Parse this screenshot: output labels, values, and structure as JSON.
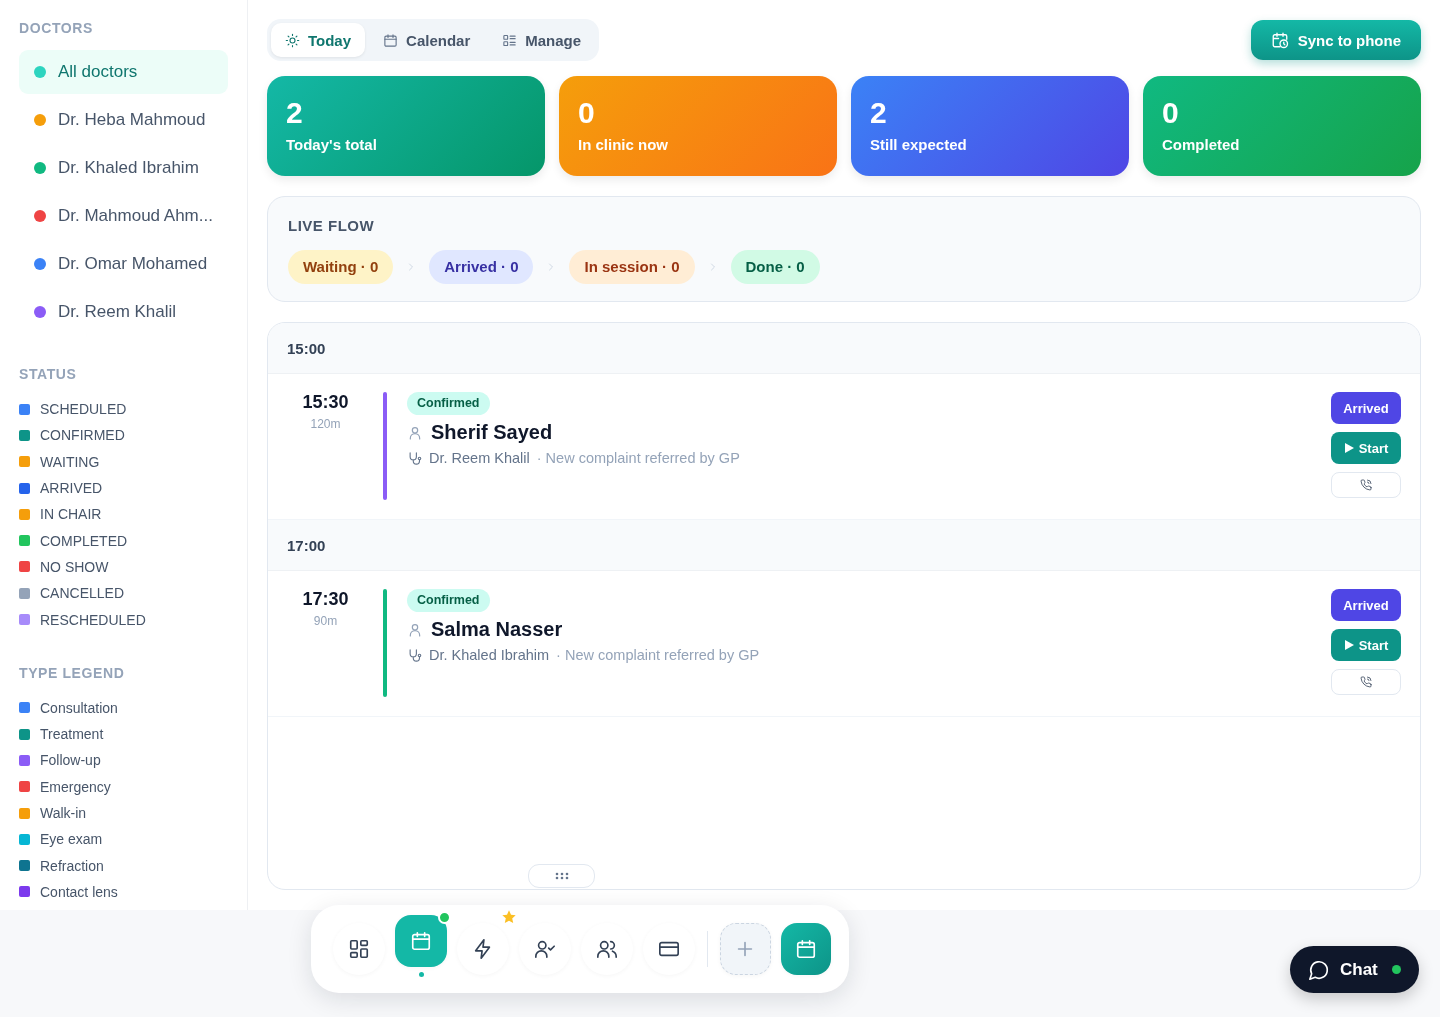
{
  "sidebar": {
    "doctors_title": "DOCTORS",
    "doctors": [
      {
        "name": "All doctors",
        "color": "#2dd4bf",
        "selected": true
      },
      {
        "name": "Dr. Heba Mahmoud",
        "color": "#f59e0b",
        "selected": false
      },
      {
        "name": "Dr. Khaled Ibrahim",
        "color": "#10b981",
        "selected": false
      },
      {
        "name": "Dr. Mahmoud Ahm...",
        "color": "#ef4444",
        "selected": false
      },
      {
        "name": "Dr. Omar Mohamed",
        "color": "#3b82f6",
        "selected": false
      },
      {
        "name": "Dr. Reem Khalil",
        "color": "#8b5cf6",
        "selected": false
      }
    ],
    "status_title": "STATUS",
    "statuses": [
      {
        "label": "SCHEDULED",
        "color": "#3b82f6"
      },
      {
        "label": "CONFIRMED",
        "color": "#0d9488"
      },
      {
        "label": "WAITING",
        "color": "#f59e0b"
      },
      {
        "label": "ARRIVED",
        "color": "#2563eb"
      },
      {
        "label": "IN CHAIR",
        "color": "#f59e0b"
      },
      {
        "label": "COMPLETED",
        "color": "#22c55e"
      },
      {
        "label": "NO SHOW",
        "color": "#ef4444"
      },
      {
        "label": "CANCELLED",
        "color": "#94a3b8"
      },
      {
        "label": "RESCHEDULED",
        "color": "#a78bfa"
      }
    ],
    "type_title": "TYPE LEGEND",
    "types": [
      {
        "label": "Consultation",
        "color": "#3b82f6"
      },
      {
        "label": "Treatment",
        "color": "#0d9488"
      },
      {
        "label": "Follow-up",
        "color": "#8b5cf6"
      },
      {
        "label": "Emergency",
        "color": "#ef4444"
      },
      {
        "label": "Walk-in",
        "color": "#f59e0b"
      },
      {
        "label": "Eye exam",
        "color": "#06b6d4"
      },
      {
        "label": "Refraction",
        "color": "#0e7490"
      },
      {
        "label": "Contact lens",
        "color": "#7c3aed"
      }
    ]
  },
  "tabs": [
    {
      "label": "Today",
      "kind": "sun",
      "selected": true
    },
    {
      "label": "Calendar",
      "kind": "calendar",
      "selected": false
    },
    {
      "label": "Manage",
      "kind": "list",
      "selected": false
    }
  ],
  "sync_button": "Sync to phone",
  "stats": [
    {
      "value": "2",
      "label": "Today's total",
      "kind": "teal"
    },
    {
      "value": "0",
      "label": "In clinic now",
      "kind": "orange"
    },
    {
      "value": "2",
      "label": "Still expected",
      "kind": "blue"
    },
    {
      "value": "0",
      "label": "Completed",
      "kind": "green"
    }
  ],
  "live_flow": {
    "title": "LIVE FLOW",
    "stages": [
      {
        "label": "Waiting · 0",
        "kind": "waiting"
      },
      {
        "label": "Arrived · 0",
        "kind": "arrived"
      },
      {
        "label": "In session · 0",
        "kind": "session"
      },
      {
        "label": "Done · 0",
        "kind": "done"
      }
    ]
  },
  "schedule": [
    {
      "hour": "15:00",
      "appointments": [
        {
          "time": "15:30",
          "duration": "120m",
          "status": "Confirmed",
          "patient": "Sherif Sayed",
          "doctor": "Dr. Reem Khalil",
          "note": "· New complaint referred by GP",
          "color": "#8b5cf6",
          "actions": [
            "Arrived",
            "Start"
          ]
        }
      ]
    },
    {
      "hour": "17:00",
      "appointments": [
        {
          "time": "17:30",
          "duration": "90m",
          "status": "Confirmed",
          "patient": "Salma Nasser",
          "doctor": "Dr. Khaled Ibrahim",
          "note": "· New complaint referred by GP",
          "color": "#10b981",
          "actions": [
            "Arrived",
            "Start"
          ]
        }
      ]
    }
  ],
  "dock": {
    "nav": [
      {
        "kind": "grid",
        "selected": false
      },
      {
        "kind": "calendar",
        "selected": true,
        "notification_dot": true
      },
      {
        "kind": "bolt",
        "selected": false,
        "starred": true
      },
      {
        "kind": "user-check",
        "selected": false
      },
      {
        "kind": "users",
        "selected": false
      },
      {
        "kind": "card",
        "selected": false
      }
    ],
    "actions": [
      {
        "kind": "add"
      },
      {
        "kind": "calendar-primary"
      }
    ]
  },
  "chat": {
    "label": "Chat",
    "online": true
  }
}
